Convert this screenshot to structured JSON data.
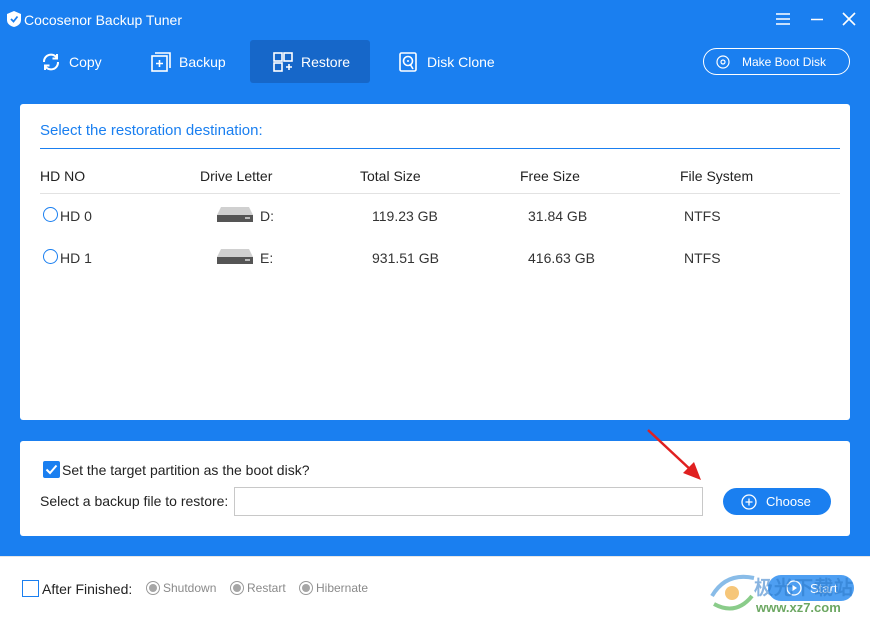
{
  "app": {
    "title": "Cocosenor Backup Tuner",
    "accent_color": "#1a7ff0"
  },
  "window_controls": {
    "menu_icon": "menu-icon",
    "minimize_icon": "minimize-icon",
    "close_icon": "close-icon"
  },
  "toolbar": {
    "tabs": [
      {
        "label": "Copy",
        "icon": "copy-icon",
        "active": false
      },
      {
        "label": "Backup",
        "icon": "backup-icon",
        "active": false
      },
      {
        "label": "Restore",
        "icon": "restore-icon",
        "active": true
      },
      {
        "label": "Disk Clone",
        "icon": "disk-clone-icon",
        "active": false
      }
    ],
    "boot_disk_label": "Make Boot Disk"
  },
  "main": {
    "title": "Select the restoration destination:",
    "columns": [
      "HD NO",
      "Drive Letter",
      "Total Size",
      "Free Size",
      "File System"
    ],
    "rows": [
      {
        "hd_no": "HD 0",
        "drive_letter": "D:",
        "total_size": "119.23 GB",
        "free_size": "31.84 GB",
        "file_system": "NTFS",
        "selected": false
      },
      {
        "hd_no": "HD 1",
        "drive_letter": "E:",
        "total_size": "931.51 GB",
        "free_size": "416.63 GB",
        "file_system": "NTFS",
        "selected": false
      }
    ]
  },
  "options": {
    "boot_checkbox_label": "Set the target partition as the boot disk?",
    "boot_checked": true,
    "file_label": "Select a backup file to restore:",
    "file_value": "",
    "choose_label": "Choose"
  },
  "footer": {
    "after_finished_label": "After Finished:",
    "after_finished_checked": false,
    "choices": [
      "Shutdown",
      "Restart",
      "Hibernate"
    ],
    "start_label": "Start"
  },
  "watermark": {
    "text": "极光下载站",
    "url": "www.xz7.com"
  }
}
